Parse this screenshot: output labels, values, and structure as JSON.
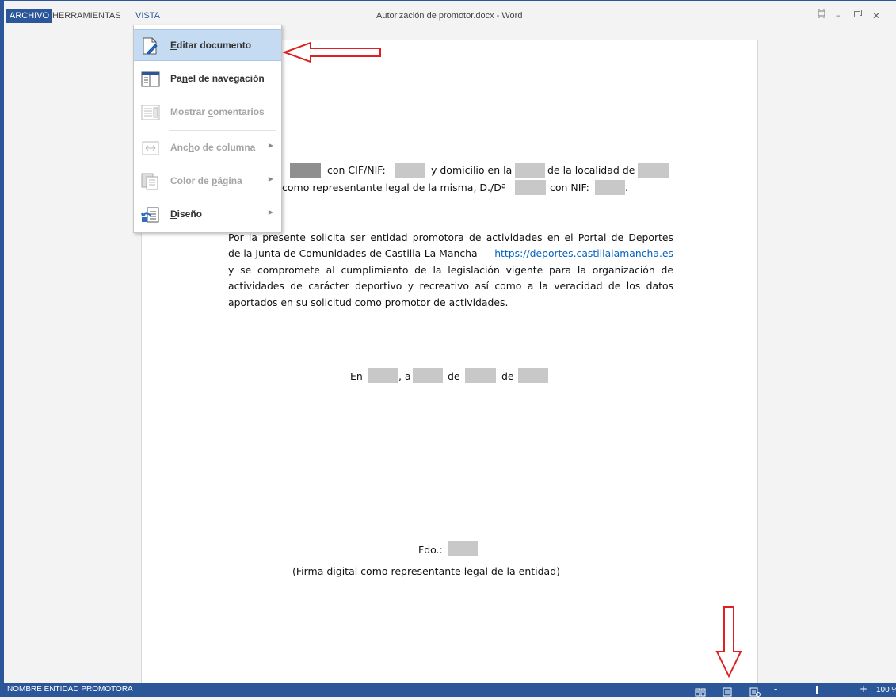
{
  "menu": {
    "archivo": "ARCHIVO",
    "herramientas": "HERRAMIENTAS",
    "vista": "VISTA"
  },
  "window": {
    "title": "Autorización de promotor.docx - Word",
    "controls": {
      "ribbon": "⌗",
      "minimize": "–",
      "restore": "🗗",
      "close": "✕"
    }
  },
  "vista_menu": {
    "items": [
      {
        "label": "Editar documento",
        "mnemonic": "E",
        "icon": "edit-document-icon",
        "enabled": true,
        "highlighted": true
      },
      {
        "label": "Panel de navegación",
        "mnemonic": "n",
        "icon": "navigation-pane-icon",
        "enabled": true
      },
      {
        "label": "Mostrar comentarios",
        "mnemonic": "c",
        "icon": "comments-icon",
        "enabled": false
      },
      {
        "label": "Ancho de columna",
        "mnemonic": "h",
        "icon": "column-width-icon",
        "enabled": false,
        "submenu": true
      },
      {
        "label": "Color de página",
        "mnemonic": "p",
        "icon": "page-color-icon",
        "enabled": false,
        "submenu": true
      },
      {
        "label": "Diseño",
        "mnemonic": "D",
        "icon": "layout-icon",
        "enabled": true,
        "submenu": true
      }
    ]
  },
  "document": {
    "line1": {
      "a": "d",
      "b": "con CIF/NIF:",
      "c": "y domicilio en la",
      "d": "de la localidad de"
    },
    "line2": {
      "a": "como representante legal de la misma, D./Dª",
      "b": "con NIF:",
      "c": "."
    },
    "paragraph": {
      "l1": "Por la presente solicita ser entidad promotora de actividades en el Portal de Deportes",
      "l2_pre": "de la Junta de Comunidades de Castilla-La Mancha",
      "link": "https://deportes.castillalamancha.es",
      "l3": "y se compromete al cumplimiento de la legislación vigente para la organización de",
      "l4": "actividades de carácter deportivo y recreativo así como a la veracidad de los datos",
      "l5": "aportados en su solicitud como promotor de actividades."
    },
    "date_line": {
      "en": "En",
      "a": ", a",
      "de1": "de",
      "de2": "de"
    },
    "signature": {
      "fdo": "Fdo.:",
      "note": "(Firma digital como representante legal de la entidad)"
    }
  },
  "statusbar": {
    "text": "NOMBRE ENTIDAD PROMOTORA",
    "zoom_minus": "-",
    "zoom_plus": "+",
    "zoom_pct": "100 %"
  },
  "colors": {
    "accent": "#2b579a",
    "highlight": "#c5dbf2",
    "annotation_arrow": "#e02020",
    "link": "#0563c1",
    "redaction": "#c8c8c8"
  }
}
